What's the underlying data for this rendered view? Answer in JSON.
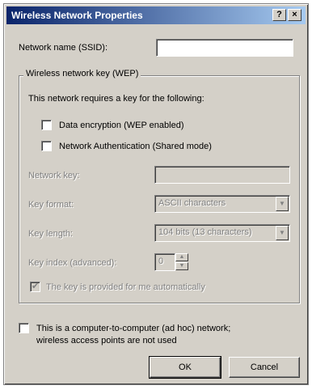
{
  "window": {
    "title": "Wireless Network Properties",
    "help_glyph": "?",
    "close_glyph": "×"
  },
  "ssid": {
    "label": "Network name (SSID):",
    "value": ""
  },
  "wep_group": {
    "title": "Wireless network key (WEP)",
    "intro": "This network requires a key for the following:",
    "data_encryption": {
      "label": "Data encryption (WEP enabled)",
      "checked": false
    },
    "network_auth": {
      "label": "Network Authentication (Shared mode)",
      "checked": false
    },
    "network_key": {
      "label": "Network key:",
      "value": ""
    },
    "key_format": {
      "label": "Key format:",
      "selected": "ASCII characters"
    },
    "key_length": {
      "label": "Key length:",
      "selected": "104 bits (13 characters)"
    },
    "key_index": {
      "label": "Key index (advanced):",
      "value": "0"
    },
    "auto_key": {
      "label": "The key is provided for me automatically",
      "checked": true,
      "check_glyph": "✔"
    }
  },
  "adhoc": {
    "label_line1": "This is a computer-to-computer (ad hoc) network;",
    "label_line2": "wireless access points are not used",
    "checked": false
  },
  "buttons": {
    "ok": "OK",
    "cancel": "Cancel"
  },
  "icons": {
    "dropdown": "▼",
    "spin_up": "▲",
    "spin_down": "▼"
  }
}
